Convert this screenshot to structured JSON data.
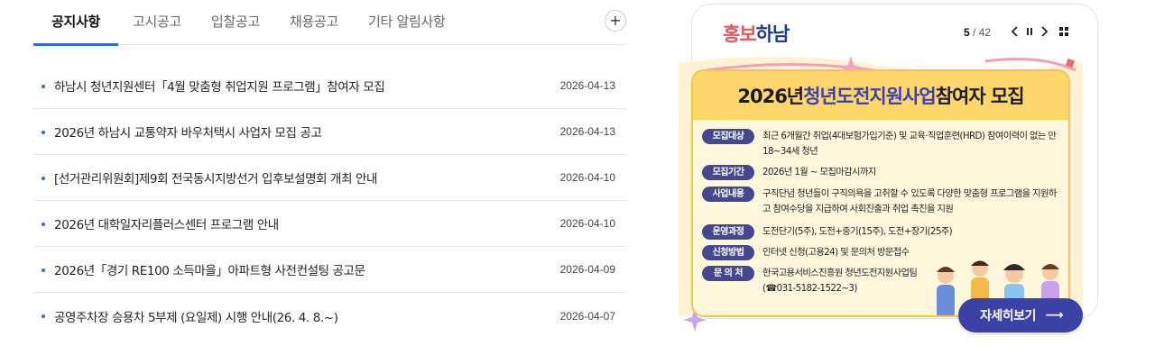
{
  "tabs": [
    {
      "label": "공지사항",
      "active": true
    },
    {
      "label": "고시공고",
      "active": false
    },
    {
      "label": "입찰공고",
      "active": false
    },
    {
      "label": "채용공고",
      "active": false
    },
    {
      "label": "기타 알림사항",
      "active": false
    }
  ],
  "more_icon": "plus-icon",
  "notices": [
    {
      "title": "하남시 청년지원센터「4월 맞춤형 취업지원 프로그램」참여자 모집",
      "date": "2026-04-13"
    },
    {
      "title": "2026년 하남시 교통약자 바우처택시 사업자 모집 공고",
      "date": "2026-04-13"
    },
    {
      "title": "[선거관리위원회]제9회 전국동시지방선거 입후보설명회 개최 안내",
      "date": "2026-04-10"
    },
    {
      "title": "2026년 대학일자리플러스센터 프로그램 안내",
      "date": "2026-04-10"
    },
    {
      "title": "2026년「경기 RE100 소득마을」아파트형 사전컨설팅 공고문",
      "date": "2026-04-09"
    },
    {
      "title": "공영주차장 승용차 5부제 (요일제) 시행 안내(26. 4. 8.~)",
      "date": "2026-04-07"
    }
  ],
  "promo": {
    "title_part1": "홍보",
    "title_part2": "하남",
    "current": "5",
    "total": "/ 42",
    "controls": [
      "chevron-left-icon",
      "pause-icon",
      "chevron-right-icon",
      "grid-icon"
    ],
    "poster": {
      "head_year": "2026년 ",
      "head_highlight": "청년도전지원사업",
      "head_rest": " 참여자 모집",
      "rows": [
        {
          "label": "모집대상",
          "text": "최근 6개월간 취업(4대보험가입기준) 및 교육·직업훈련(HRD) 참여이력이 없는 만18~34세 청년"
        },
        {
          "label": "모집기간",
          "text": "2026년 1월 ~ 모집마감시까지"
        },
        {
          "label": "사업내용",
          "text": "구직단념 청년들이 구직의욕을 고취할 수 있도록 다양한 맞춤형 프로그램을 지원하고 참여수당을 지급하여 사회진출과 취업 촉진을 지원"
        },
        {
          "label": "운영과정",
          "text": "도전단기(5주), 도전+중기(15주), 도전+장기(25주)"
        },
        {
          "label": "신청방법",
          "text": "인터넷 신청(고용24) 및 문의처 방문접수"
        },
        {
          "label": "문 의 처",
          "text": "한국고용서비스진흥원 청년도전지원사업팀 (☎031-5182-1522~3)"
        }
      ]
    },
    "detail_label": "자세히보기",
    "colors": {
      "accent_blue": "#2f6bd8",
      "poster_yellow": "#ffd66b",
      "button_indigo": "#3b42a6",
      "brand_red": "#e85560",
      "brand_navy": "#1e3a8a"
    }
  }
}
